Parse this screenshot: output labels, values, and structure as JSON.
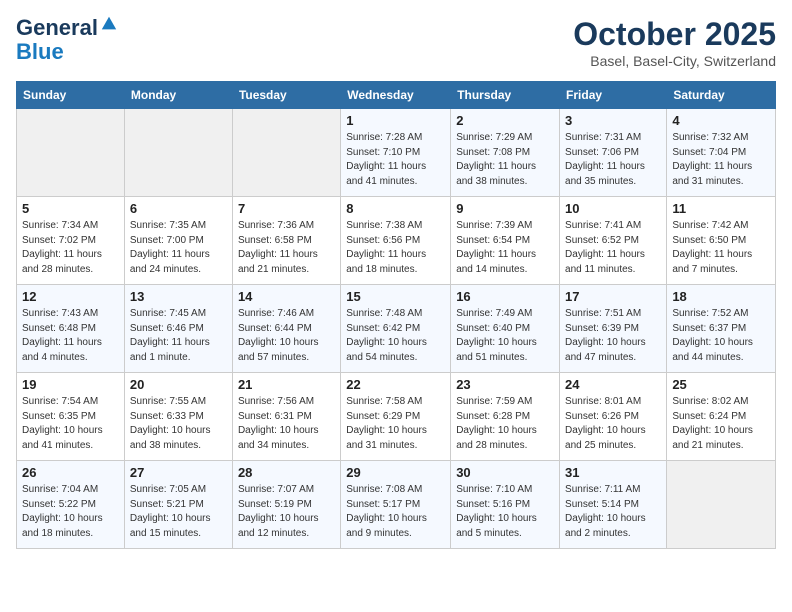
{
  "header": {
    "logo_line1": "General",
    "logo_line2": "Blue",
    "month_title": "October 2025",
    "location": "Basel, Basel-City, Switzerland"
  },
  "days_of_week": [
    "Sunday",
    "Monday",
    "Tuesday",
    "Wednesday",
    "Thursday",
    "Friday",
    "Saturday"
  ],
  "weeks": [
    [
      {
        "day": "",
        "detail": ""
      },
      {
        "day": "",
        "detail": ""
      },
      {
        "day": "",
        "detail": ""
      },
      {
        "day": "1",
        "detail": "Sunrise: 7:28 AM\nSunset: 7:10 PM\nDaylight: 11 hours and 41 minutes."
      },
      {
        "day": "2",
        "detail": "Sunrise: 7:29 AM\nSunset: 7:08 PM\nDaylight: 11 hours and 38 minutes."
      },
      {
        "day": "3",
        "detail": "Sunrise: 7:31 AM\nSunset: 7:06 PM\nDaylight: 11 hours and 35 minutes."
      },
      {
        "day": "4",
        "detail": "Sunrise: 7:32 AM\nSunset: 7:04 PM\nDaylight: 11 hours and 31 minutes."
      }
    ],
    [
      {
        "day": "5",
        "detail": "Sunrise: 7:34 AM\nSunset: 7:02 PM\nDaylight: 11 hours and 28 minutes."
      },
      {
        "day": "6",
        "detail": "Sunrise: 7:35 AM\nSunset: 7:00 PM\nDaylight: 11 hours and 24 minutes."
      },
      {
        "day": "7",
        "detail": "Sunrise: 7:36 AM\nSunset: 6:58 PM\nDaylight: 11 hours and 21 minutes."
      },
      {
        "day": "8",
        "detail": "Sunrise: 7:38 AM\nSunset: 6:56 PM\nDaylight: 11 hours and 18 minutes."
      },
      {
        "day": "9",
        "detail": "Sunrise: 7:39 AM\nSunset: 6:54 PM\nDaylight: 11 hours and 14 minutes."
      },
      {
        "day": "10",
        "detail": "Sunrise: 7:41 AM\nSunset: 6:52 PM\nDaylight: 11 hours and 11 minutes."
      },
      {
        "day": "11",
        "detail": "Sunrise: 7:42 AM\nSunset: 6:50 PM\nDaylight: 11 hours and 7 minutes."
      }
    ],
    [
      {
        "day": "12",
        "detail": "Sunrise: 7:43 AM\nSunset: 6:48 PM\nDaylight: 11 hours and 4 minutes."
      },
      {
        "day": "13",
        "detail": "Sunrise: 7:45 AM\nSunset: 6:46 PM\nDaylight: 11 hours and 1 minute."
      },
      {
        "day": "14",
        "detail": "Sunrise: 7:46 AM\nSunset: 6:44 PM\nDaylight: 10 hours and 57 minutes."
      },
      {
        "day": "15",
        "detail": "Sunrise: 7:48 AM\nSunset: 6:42 PM\nDaylight: 10 hours and 54 minutes."
      },
      {
        "day": "16",
        "detail": "Sunrise: 7:49 AM\nSunset: 6:40 PM\nDaylight: 10 hours and 51 minutes."
      },
      {
        "day": "17",
        "detail": "Sunrise: 7:51 AM\nSunset: 6:39 PM\nDaylight: 10 hours and 47 minutes."
      },
      {
        "day": "18",
        "detail": "Sunrise: 7:52 AM\nSunset: 6:37 PM\nDaylight: 10 hours and 44 minutes."
      }
    ],
    [
      {
        "day": "19",
        "detail": "Sunrise: 7:54 AM\nSunset: 6:35 PM\nDaylight: 10 hours and 41 minutes."
      },
      {
        "day": "20",
        "detail": "Sunrise: 7:55 AM\nSunset: 6:33 PM\nDaylight: 10 hours and 38 minutes."
      },
      {
        "day": "21",
        "detail": "Sunrise: 7:56 AM\nSunset: 6:31 PM\nDaylight: 10 hours and 34 minutes."
      },
      {
        "day": "22",
        "detail": "Sunrise: 7:58 AM\nSunset: 6:29 PM\nDaylight: 10 hours and 31 minutes."
      },
      {
        "day": "23",
        "detail": "Sunrise: 7:59 AM\nSunset: 6:28 PM\nDaylight: 10 hours and 28 minutes."
      },
      {
        "day": "24",
        "detail": "Sunrise: 8:01 AM\nSunset: 6:26 PM\nDaylight: 10 hours and 25 minutes."
      },
      {
        "day": "25",
        "detail": "Sunrise: 8:02 AM\nSunset: 6:24 PM\nDaylight: 10 hours and 21 minutes."
      }
    ],
    [
      {
        "day": "26",
        "detail": "Sunrise: 7:04 AM\nSunset: 5:22 PM\nDaylight: 10 hours and 18 minutes."
      },
      {
        "day": "27",
        "detail": "Sunrise: 7:05 AM\nSunset: 5:21 PM\nDaylight: 10 hours and 15 minutes."
      },
      {
        "day": "28",
        "detail": "Sunrise: 7:07 AM\nSunset: 5:19 PM\nDaylight: 10 hours and 12 minutes."
      },
      {
        "day": "29",
        "detail": "Sunrise: 7:08 AM\nSunset: 5:17 PM\nDaylight: 10 hours and 9 minutes."
      },
      {
        "day": "30",
        "detail": "Sunrise: 7:10 AM\nSunset: 5:16 PM\nDaylight: 10 hours and 5 minutes."
      },
      {
        "day": "31",
        "detail": "Sunrise: 7:11 AM\nSunset: 5:14 PM\nDaylight: 10 hours and 2 minutes."
      },
      {
        "day": "",
        "detail": ""
      }
    ]
  ]
}
